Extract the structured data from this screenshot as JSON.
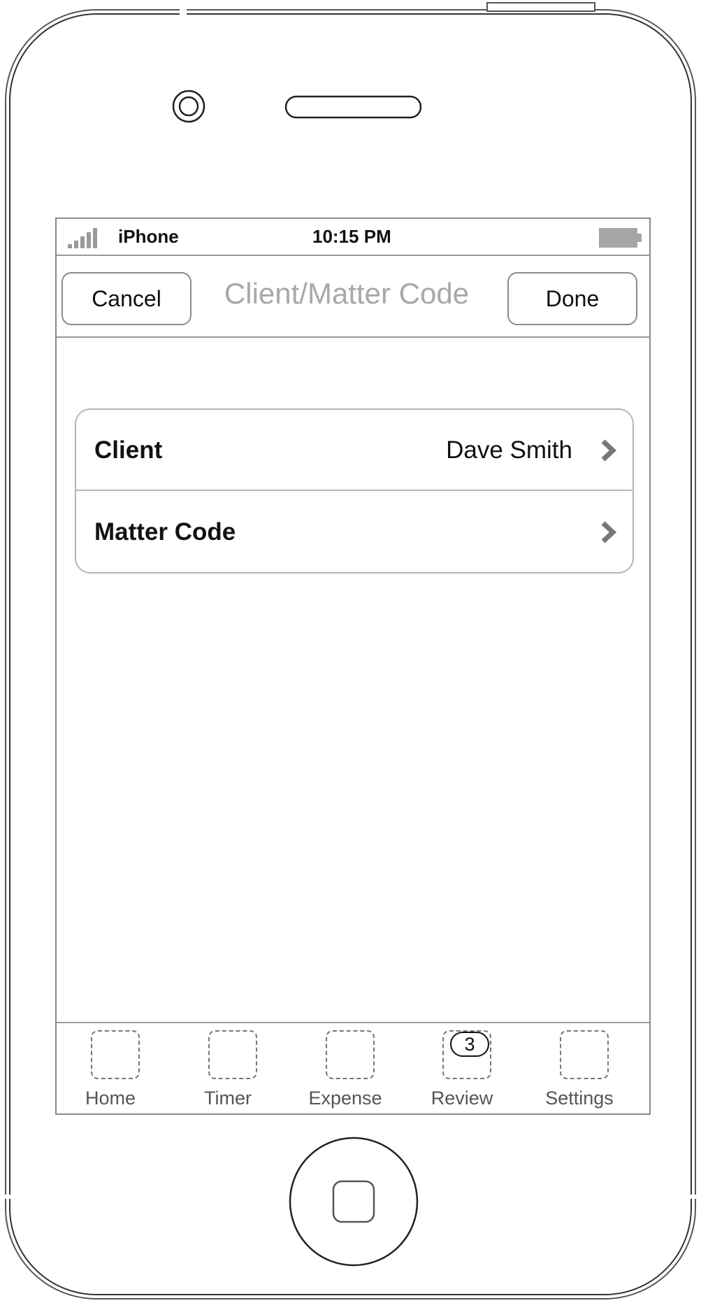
{
  "status_bar": {
    "carrier": "iPhone",
    "time": "10:15 PM",
    "signal_icon": "signal-bars-icon",
    "battery_icon": "battery-icon"
  },
  "nav_bar": {
    "title": "Client/Matter Code",
    "left_button": "Cancel",
    "right_button": "Done"
  },
  "table": {
    "rows": [
      {
        "label": "Client",
        "value": "Dave Smith",
        "accessory": "chevron-right-icon"
      },
      {
        "label": "Matter Code",
        "value": "",
        "accessory": "chevron-right-icon"
      }
    ]
  },
  "tab_bar": {
    "tabs": [
      {
        "label": "Home",
        "icon": "placeholder-icon"
      },
      {
        "label": "Timer",
        "icon": "placeholder-icon"
      },
      {
        "label": "Expense",
        "icon": "placeholder-icon"
      },
      {
        "label": "Review",
        "icon": "placeholder-icon",
        "badge": "3"
      },
      {
        "label": "Settings",
        "icon": "placeholder-icon"
      }
    ]
  }
}
